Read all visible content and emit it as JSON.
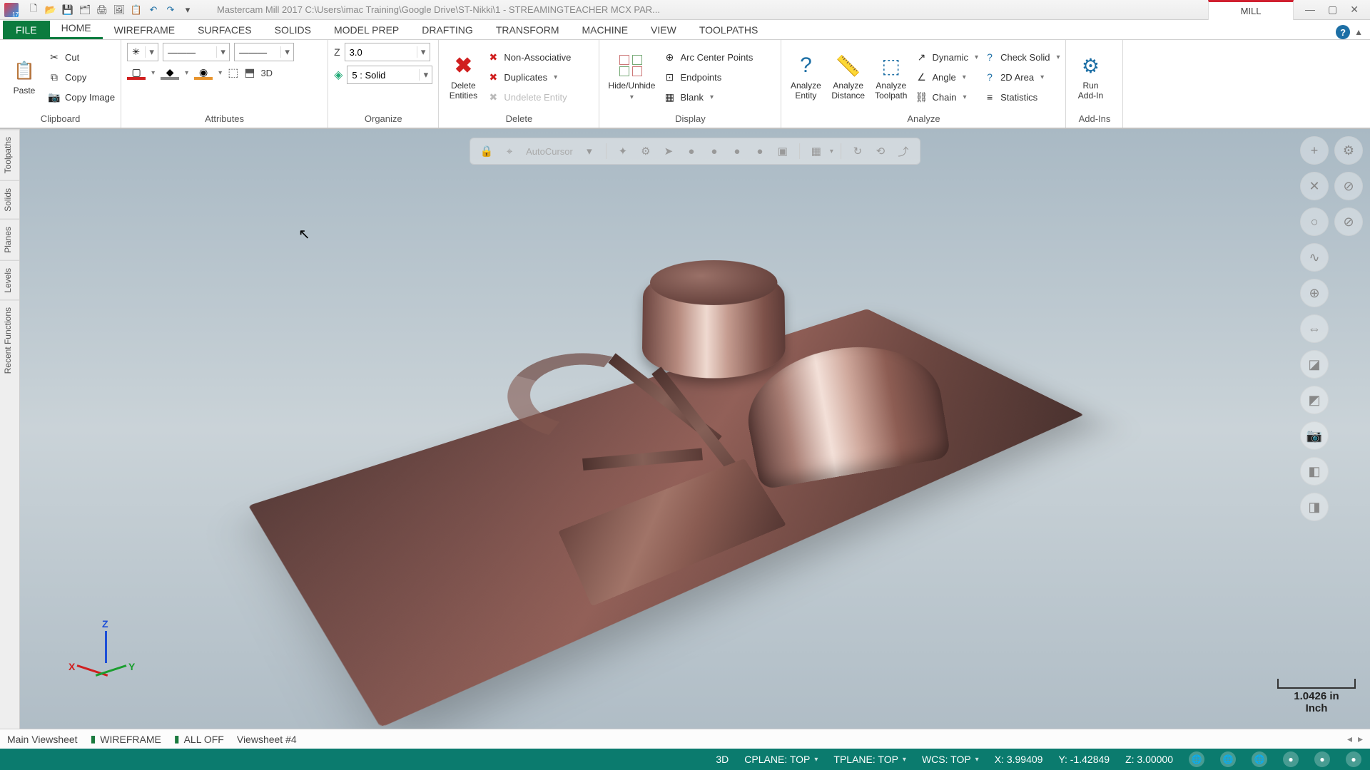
{
  "title": "Mastercam Mill 2017   C:\\Users\\imac Training\\Google Drive\\ST-Nikki\\1 - STREAMINGTEACHER MCX PAR...",
  "context_tab": "MILL",
  "qat": [
    "new",
    "open",
    "save",
    "save-as",
    "print",
    "print-preview",
    "folder",
    "undo",
    "redo",
    "customize"
  ],
  "ribbon_tabs": [
    "HOME",
    "WIREFRAME",
    "SURFACES",
    "SOLIDS",
    "MODEL PREP",
    "DRAFTING",
    "TRANSFORM",
    "MACHINE",
    "VIEW",
    "TOOLPATHS"
  ],
  "active_tab": "HOME",
  "file_tab": "FILE",
  "clipboard": {
    "paste": "Paste",
    "cut": "Cut",
    "copy": "Copy",
    "copy_image": "Copy Image",
    "group": "Clipboard"
  },
  "attributes": {
    "group": "Attributes",
    "point_style": "✳",
    "line_style": "———",
    "line_width": "———",
    "z_label": "Z",
    "z_value": "3.0",
    "level": "5 : Solid",
    "threeD": "3D"
  },
  "organize": {
    "group": "Organize"
  },
  "delete": {
    "group": "Delete",
    "delete_entities": "Delete\nEntities",
    "non_assoc": "Non-Associative",
    "duplicates": "Duplicates",
    "undelete": "Undelete Entity"
  },
  "display": {
    "group": "Display",
    "hide": "Hide/Unhide",
    "arc_center": "Arc Center Points",
    "endpoints": "Endpoints",
    "blank": "Blank"
  },
  "analyze": {
    "group": "Analyze",
    "entity": "Analyze\nEntity",
    "distance": "Analyze\nDistance",
    "toolpath": "Analyze\nToolpath",
    "dynamic": "Dynamic",
    "angle": "Angle",
    "chain": "Chain",
    "check_solid": "Check Solid",
    "area": "2D Area",
    "statistics": "Statistics"
  },
  "addins": {
    "run": "Run\nAdd-In",
    "group": "Add-Ins"
  },
  "side_tabs": [
    "Toolpaths",
    "Solids",
    "Planes",
    "Levels",
    "Recent Functions"
  ],
  "float_toolbar": {
    "autocursor": "AutoCursor"
  },
  "gnomon": {
    "x": "X",
    "y": "Y",
    "z": "Z"
  },
  "scale": {
    "value": "1.0426 in",
    "unit": "Inch"
  },
  "viewsheets": {
    "main": "Main Viewsheet",
    "wireframe": "WIREFRAME",
    "alloff": "ALL OFF",
    "sheet4": "Viewsheet #4"
  },
  "status": {
    "mode": "3D",
    "cplane": "CPLANE: TOP",
    "tplane": "TPLANE: TOP",
    "wcs": "WCS: TOP",
    "x": "X:   3.99409",
    "y": "Y:   -1.42849",
    "z": "Z:   3.00000"
  }
}
